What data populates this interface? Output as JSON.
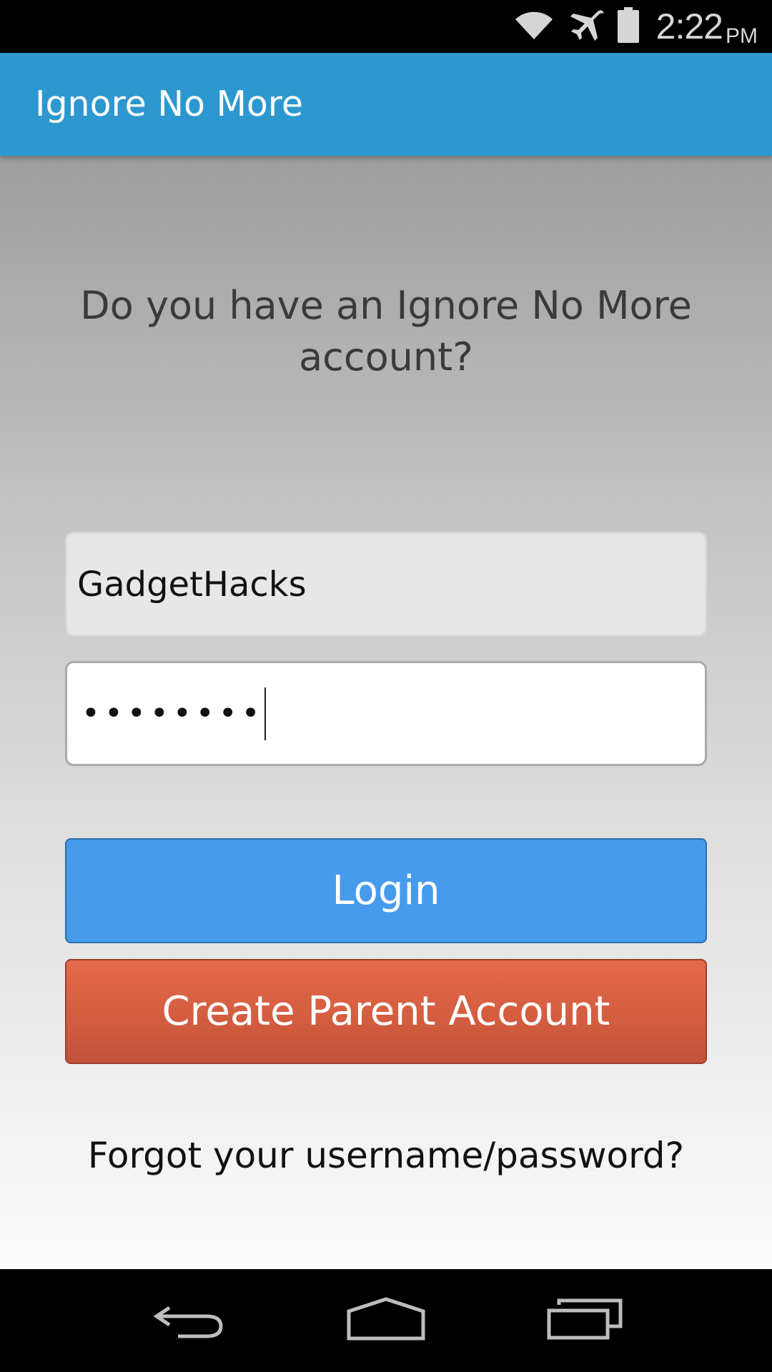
{
  "status_bar": {
    "time": "2:22",
    "ampm": "PM",
    "icons": [
      "wifi-icon",
      "airplane-icon",
      "battery-icon"
    ]
  },
  "app_bar": {
    "title": "Ignore No More",
    "color": "#2c98cf"
  },
  "login": {
    "prompt": "Do you have an Ignore No More account?",
    "username_value": "GadgetHacks",
    "password_masked": "••••••••",
    "login_label": "Login",
    "login_color": "#479bec",
    "create_label": "Create Parent Account",
    "create_color": "#d45d40",
    "forgot_label": "Forgot your username/password?"
  },
  "nav_bar": {
    "buttons": [
      "back-icon",
      "home-icon",
      "recents-icon"
    ]
  }
}
